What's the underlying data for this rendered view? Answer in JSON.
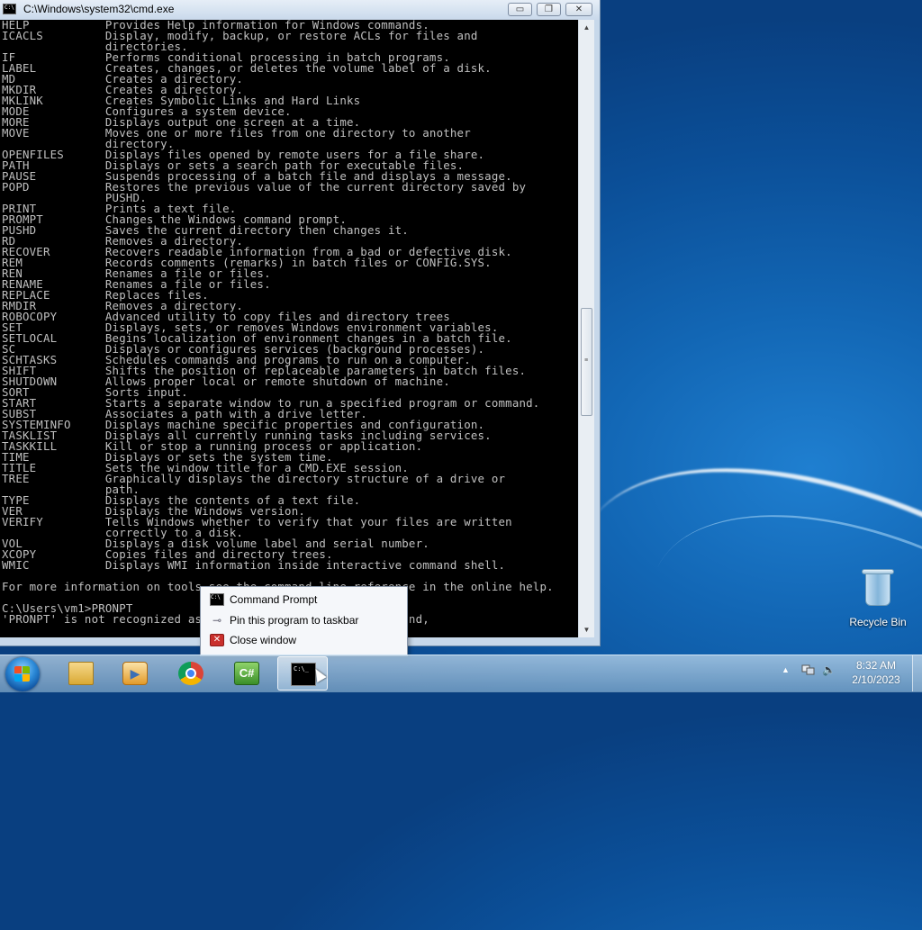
{
  "window": {
    "title": "C:\\Windows\\system32\\cmd.exe",
    "icon_text": "C:\\",
    "buttons": {
      "minimize": "▭",
      "maximize": "❐",
      "close": "✕"
    }
  },
  "console": {
    "lines": [
      "HELP           Provides Help information for Windows commands.",
      "ICACLS         Display, modify, backup, or restore ACLs for files and",
      "               directories.",
      "IF             Performs conditional processing in batch programs.",
      "LABEL          Creates, changes, or deletes the volume label of a disk.",
      "MD             Creates a directory.",
      "MKDIR          Creates a directory.",
      "MKLINK         Creates Symbolic Links and Hard Links",
      "MODE           Configures a system device.",
      "MORE           Displays output one screen at a time.",
      "MOVE           Moves one or more files from one directory to another",
      "               directory.",
      "OPENFILES      Displays files opened by remote users for a file share.",
      "PATH           Displays or sets a search path for executable files.",
      "PAUSE          Suspends processing of a batch file and displays a message.",
      "POPD           Restores the previous value of the current directory saved by",
      "               PUSHD.",
      "PRINT          Prints a text file.",
      "PROMPT         Changes the Windows command prompt.",
      "PUSHD          Saves the current directory then changes it.",
      "RD             Removes a directory.",
      "RECOVER        Recovers readable information from a bad or defective disk.",
      "REM            Records comments (remarks) in batch files or CONFIG.SYS.",
      "REN            Renames a file or files.",
      "RENAME         Renames a file or files.",
      "REPLACE        Replaces files.",
      "RMDIR          Removes a directory.",
      "ROBOCOPY       Advanced utility to copy files and directory trees",
      "SET            Displays, sets, or removes Windows environment variables.",
      "SETLOCAL       Begins localization of environment changes in a batch file.",
      "SC             Displays or configures services (background processes).",
      "SCHTASKS       Schedules commands and programs to run on a computer.",
      "SHIFT          Shifts the position of replaceable parameters in batch files.",
      "SHUTDOWN       Allows proper local or remote shutdown of machine.",
      "SORT           Sorts input.",
      "START          Starts a separate window to run a specified program or command.",
      "SUBST          Associates a path with a drive letter.",
      "SYSTEMINFO     Displays machine specific properties and configuration.",
      "TASKLIST       Displays all currently running tasks including services.",
      "TASKKILL       Kill or stop a running process or application.",
      "TIME           Displays or sets the system time.",
      "TITLE          Sets the window title for a CMD.EXE session.",
      "TREE           Graphically displays the directory structure of a drive or",
      "               path.",
      "TYPE           Displays the contents of a text file.",
      "VER            Displays the Windows version.",
      "VERIFY         Tells Windows whether to verify that your files are written",
      "               correctly to a disk.",
      "VOL            Displays a disk volume label and serial number.",
      "XCOPY          Copies files and directory trees.",
      "WMIC           Displays WMI information inside interactive command shell.",
      "",
      "For more information on tools see the command-line reference in the online help.",
      "",
      "C:\\Users\\vm1>PRONPT",
      "'PRONPT' is not recognized as an internal or external command,"
    ]
  },
  "jumplist": {
    "items": [
      {
        "label": "Command Prompt",
        "icon": "cmd-icon"
      },
      {
        "label": "Pin this program to taskbar",
        "icon": "pin-icon"
      },
      {
        "label": "Close window",
        "icon": "close-icon"
      }
    ]
  },
  "desktop": {
    "recycle_bin_label": "Recycle Bin"
  },
  "taskbar": {
    "apps": [
      "windows-explorer",
      "windows-media-player",
      "google-chrome",
      "csharp-app",
      "command-prompt"
    ],
    "csharp_text": "C#",
    "clock_time": "8:32 AM",
    "clock_date": "2/10/2023"
  },
  "colors": {
    "console_bg": "#000000",
    "console_text": "#c0c0c0",
    "desktop_blue": "#1266b4"
  }
}
